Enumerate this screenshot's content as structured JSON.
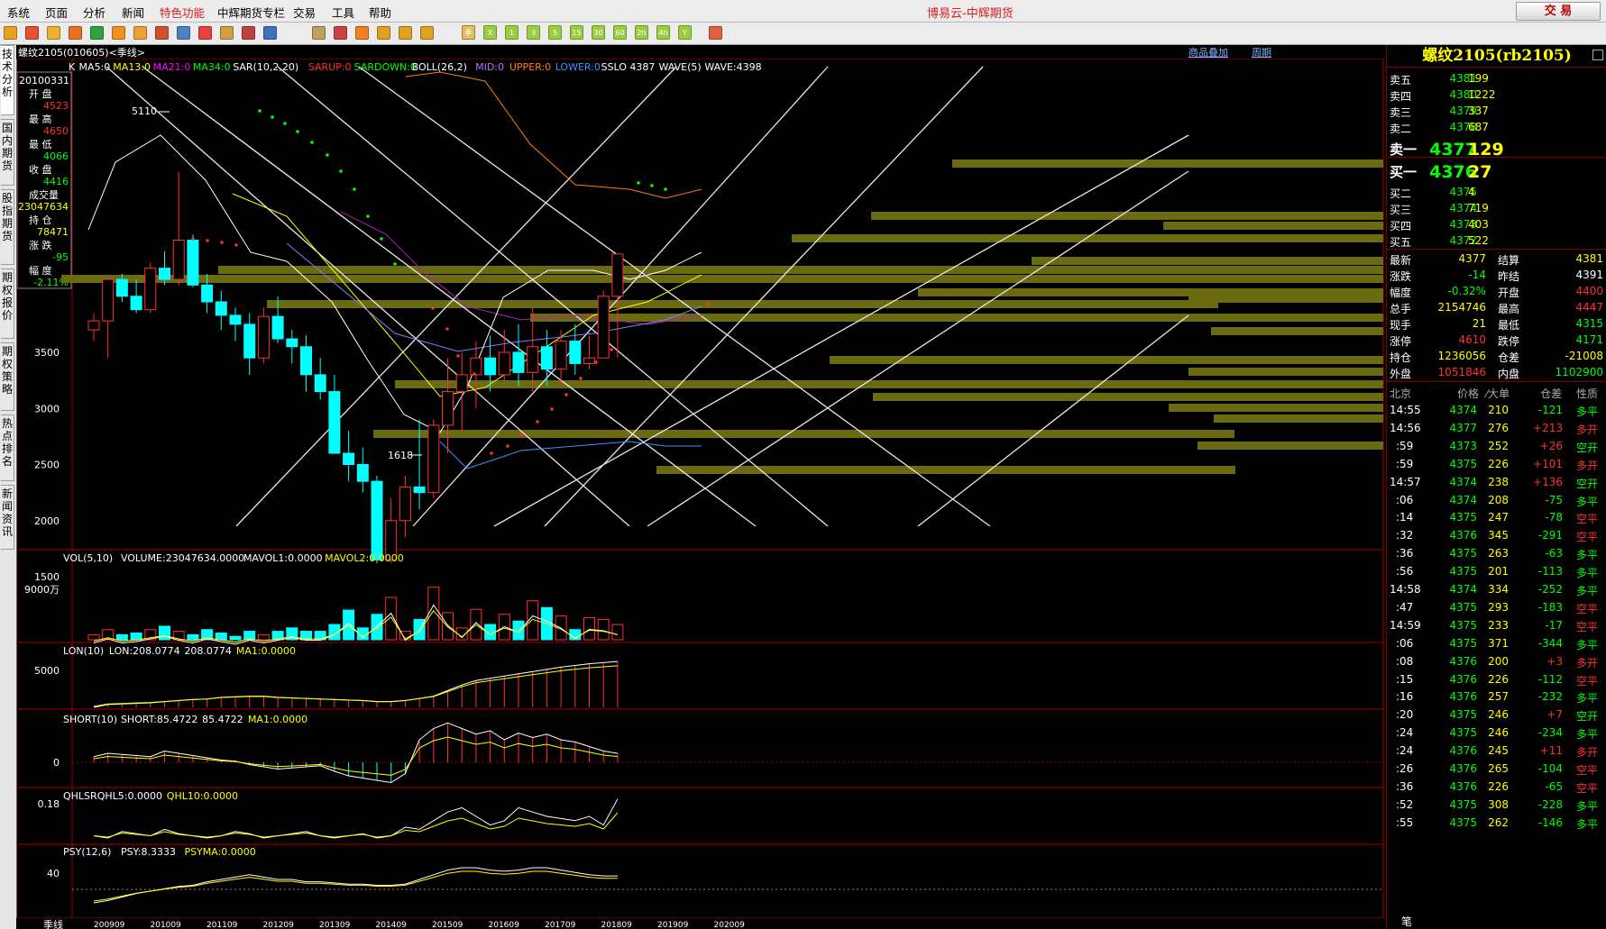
{
  "menu": {
    "items": [
      "系统",
      "页面",
      "分析",
      "新闻",
      "特色功能",
      "中辉期货专栏",
      "交易",
      "工具",
      "帮助"
    ],
    "app_title": "博易云-中辉期货",
    "trade_label": "交 易"
  },
  "toolbar": {
    "period_labels": [
      "日",
      "周",
      "月",
      "季",
      "X",
      "1",
      "3",
      "5",
      "15",
      "30",
      "60",
      "2h",
      "4h",
      "Y"
    ]
  },
  "sidetabs": [
    "技术分析",
    "国内期货",
    "股指期货",
    "期权报价",
    "期权策略",
    "热点排名",
    "新闻资讯"
  ],
  "chart": {
    "header": "螺纹2105(010605)<季线>",
    "link1": "商品叠加",
    "link2": "周期",
    "main_indicator_segments": [
      {
        "text": "K",
        "color": "#ffffff"
      },
      {
        "text": "MA5:0",
        "color": "#ffffff"
      },
      {
        "text": "MA13:0",
        "color": "#ffff00"
      },
      {
        "text": "MA21:0",
        "color": "#ff00ff"
      },
      {
        "text": "MA34:0",
        "color": "#00ff00"
      },
      {
        "text": "SAR(10,2,20)",
        "color": "#ffffff"
      },
      {
        "text": "SARUP:0",
        "color": "#ff3030"
      },
      {
        "text": "SARDOWN:0",
        "color": "#00ff00"
      },
      {
        "text": "BOLL(26,2)",
        "color": "#ffffff"
      },
      {
        "text": "MID:0",
        "color": "#b070ff"
      },
      {
        "text": "UPPER:0",
        "color": "#ff8000"
      },
      {
        "text": "LOWER:0",
        "color": "#4090ff"
      },
      {
        "text": "SSLO 4387",
        "color": "#ffffff"
      },
      {
        "text": "WAVE(5)",
        "color": "#ffffff"
      },
      {
        "text": "WAVE:4398",
        "color": "#ffffff"
      }
    ],
    "info_box": {
      "date": "20100331",
      "items": [
        {
          "label": "开 盘",
          "value": "4523",
          "color": "#ff3030"
        },
        {
          "label": "最 高",
          "value": "4650",
          "color": "#ff3030"
        },
        {
          "label": "最 低",
          "value": "4066",
          "color": "#00ff00"
        },
        {
          "label": "收 盘",
          "value": "4416",
          "color": "#00ff00"
        },
        {
          "label": "成交量",
          "value": "23047634",
          "color": "#ffff00"
        },
        {
          "label": "持 仓",
          "value": "78471",
          "color": "#ffff00"
        },
        {
          "label": "涨 跌",
          "value": "-95",
          "color": "#00ff00"
        },
        {
          "label": "幅 度",
          "value": "-2.11%",
          "color": "#00ff00"
        }
      ]
    },
    "y_axis_labels": [
      "3500",
      "3000",
      "2500",
      "2000",
      "1500"
    ],
    "peak_label": "5110",
    "trough_label": "1618",
    "vol_header": [
      {
        "text": "VOL(5,10)",
        "color": "#ffffff"
      },
      {
        "text": "VOLUME:23047634.0000",
        "color": "#ffffff"
      },
      {
        "text": "MAVOL1:0.0000",
        "color": "#ffffff"
      },
      {
        "text": "MAVOL2:0.0000",
        "color": "#ffff00"
      }
    ],
    "vol_axis": "9000万",
    "lon_header": [
      {
        "text": "LON(10)",
        "color": "#ffffff"
      },
      {
        "text": "LON:208.0774",
        "color": "#ffffff"
      },
      {
        "text": "208.0774",
        "color": "#ffffff"
      },
      {
        "text": "MA1:0.0000",
        "color": "#ffff00"
      }
    ],
    "lon_axis": "5000",
    "short_header": [
      {
        "text": "SHORT(10)",
        "color": "#ffffff"
      },
      {
        "text": "SHORT:85.4722",
        "color": "#ffffff"
      },
      {
        "text": "85.4722",
        "color": "#ffffff"
      },
      {
        "text": "MA1:0.0000",
        "color": "#ffff00"
      }
    ],
    "short_axis": "0",
    "qhlsr_header": [
      {
        "text": "QHLSR",
        "color": "#ffffff"
      },
      {
        "text": "QHL5:0.0000",
        "color": "#ffffff"
      },
      {
        "text": "QHL10:0.0000",
        "color": "#ffff00"
      }
    ],
    "qhlsr_axis": "0.18",
    "psy_header": [
      {
        "text": "PSY(12,6)",
        "color": "#ffffff"
      },
      {
        "text": "PSY:8.3333",
        "color": "#ffffff"
      },
      {
        "text": "PSYMA:0.0000",
        "color": "#ffff00"
      }
    ],
    "psy_axis": "40",
    "x_axis_label": "季线",
    "x_dates": [
      "200909",
      "201009",
      "201109",
      "201209",
      "201309",
      "201409",
      "201509",
      "201609",
      "201709",
      "201809",
      "201909",
      "202009"
    ],
    "candles": [
      [
        3700,
        3850,
        3600,
        3780
      ],
      [
        3780,
        3900,
        3450,
        4150
      ],
      [
        4150,
        4200,
        3950,
        4000
      ],
      [
        4000,
        4150,
        3850,
        3880
      ],
      [
        3880,
        4300,
        3850,
        4250
      ],
      [
        4250,
        4400,
        4100,
        4150
      ],
      [
        4150,
        5110,
        4100,
        4500
      ],
      [
        4500,
        4550,
        4080,
        4100
      ],
      [
        4100,
        4200,
        3850,
        3950
      ],
      [
        3950,
        4050,
        3700,
        3830
      ],
      [
        3830,
        3900,
        3600,
        3750
      ],
      [
        3750,
        3850,
        3300,
        3450
      ],
      [
        3450,
        3900,
        3400,
        3820
      ],
      [
        3820,
        4000,
        3580,
        3620
      ],
      [
        3620,
        3700,
        3400,
        3550
      ],
      [
        3550,
        3650,
        3150,
        3300
      ],
      [
        3300,
        3450,
        3080,
        3150
      ],
      [
        3150,
        3300,
        2800,
        2600
      ],
      [
        2600,
        2800,
        2350,
        2500
      ],
      [
        2500,
        2650,
        2250,
        2350
      ],
      [
        2350,
        2400,
        1618,
        1650
      ],
      [
        1650,
        2200,
        1620,
        2000
      ],
      [
        2000,
        2400,
        1850,
        2300
      ],
      [
        2300,
        2900,
        2100,
        2250
      ],
      [
        2250,
        2900,
        2200,
        2850
      ],
      [
        2850,
        3450,
        2600,
        3150
      ],
      [
        3150,
        3500,
        2800,
        3300
      ],
      [
        3300,
        3600,
        3000,
        3450
      ],
      [
        3450,
        3650,
        3150,
        3300
      ],
      [
        3300,
        3700,
        3250,
        3500
      ],
      [
        3500,
        3750,
        3200,
        3320
      ],
      [
        3320,
        3900,
        3150,
        3550
      ],
      [
        3550,
        3700,
        3200,
        3350
      ],
      [
        3350,
        3700,
        3200,
        3600
      ],
      [
        3600,
        3750,
        3300,
        3400
      ],
      [
        3400,
        3650,
        3350,
        3450
      ],
      [
        3450,
        4050,
        3700,
        4000
      ],
      [
        4000,
        4100,
        3450,
        4377
      ]
    ],
    "volumes": [
      6,
      12,
      6,
      8,
      12,
      16,
      10,
      6,
      12,
      8,
      4,
      10,
      6,
      10,
      14,
      10,
      10,
      18,
      35,
      14,
      30,
      50,
      10,
      24,
      62,
      32,
      14,
      36,
      18,
      30,
      22,
      46,
      38,
      28,
      12,
      26,
      24,
      18
    ],
    "lon": [
      0,
      5,
      6,
      7,
      8,
      10,
      12,
      14,
      15,
      18,
      19,
      20,
      20,
      18,
      17,
      16,
      15,
      14,
      13,
      12,
      10,
      10,
      12,
      16,
      20,
      30,
      40,
      48,
      52,
      56,
      60,
      64,
      68,
      72,
      75,
      78,
      80,
      82
    ],
    "short_vals": [
      5,
      8,
      7,
      6,
      5,
      10,
      8,
      6,
      4,
      2,
      1,
      -2,
      -4,
      -6,
      -5,
      -4,
      -3,
      -8,
      -12,
      -14,
      -16,
      -18,
      -10,
      20,
      30,
      35,
      30,
      25,
      28,
      20,
      26,
      22,
      25,
      20,
      18,
      14,
      10,
      8
    ],
    "qhlsr": [
      0.01,
      0.0,
      0.03,
      0.02,
      0.01,
      0.04,
      0.02,
      0.01,
      0.0,
      0.01,
      0.03,
      0.02,
      0.0,
      0.01,
      0.02,
      0.03,
      0.01,
      0.0,
      0.01,
      0.02,
      0.0,
      0.01,
      0.05,
      0.04,
      0.08,
      0.12,
      0.14,
      0.1,
      0.06,
      0.08,
      0.14,
      0.12,
      0.1,
      0.09,
      0.08,
      0.1,
      0.06,
      0.18
    ],
    "psy": [
      10,
      12,
      15,
      18,
      20,
      22,
      24,
      25,
      28,
      30,
      32,
      34,
      32,
      30,
      30,
      28,
      28,
      27,
      26,
      26,
      25,
      25,
      26,
      30,
      34,
      38,
      40,
      40,
      38,
      37,
      38,
      40,
      40,
      38,
      36,
      34,
      33,
      33
    ]
  },
  "quote": {
    "title": "螺纹2105(rb2105)",
    "asks": [
      {
        "label": "卖五",
        "price": "4381",
        "vol": "199"
      },
      {
        "label": "卖四",
        "price": "4380",
        "vol": "1222"
      },
      {
        "label": "卖三",
        "price": "4379",
        "vol": "337"
      },
      {
        "label": "卖二",
        "price": "4378",
        "vol": "687"
      },
      {
        "label": "卖一",
        "price": "4377",
        "vol": "129"
      }
    ],
    "bids": [
      {
        "label": "买一",
        "price": "4376",
        "vol": "27"
      },
      {
        "label": "买二",
        "price": "4375",
        "vol": "4"
      },
      {
        "label": "买三",
        "price": "4374",
        "vol": "719"
      },
      {
        "label": "买四",
        "price": "4373",
        "vol": "403"
      },
      {
        "label": "买五",
        "price": "4372",
        "vol": "522"
      }
    ],
    "stats": [
      [
        {
          "t": "最新",
          "c": "#ffffff"
        },
        {
          "t": "4377",
          "c": "#ffff00"
        },
        {
          "t": "结算",
          "c": "#ffffff"
        },
        {
          "t": "4381",
          "c": "#ffff00"
        }
      ],
      [
        {
          "t": "涨跌",
          "c": "#ffffff"
        },
        {
          "t": "-14",
          "c": "#00ff00"
        },
        {
          "t": "昨结",
          "c": "#ffffff"
        },
        {
          "t": "4391",
          "c": "#ffffff"
        }
      ],
      [
        {
          "t": "幅度",
          "c": "#ffffff"
        },
        {
          "t": "-0.32%",
          "c": "#00ff00"
        },
        {
          "t": "开盘",
          "c": "#ffffff"
        },
        {
          "t": "4400",
          "c": "#ff3030"
        }
      ],
      [
        {
          "t": "总手",
          "c": "#ffffff"
        },
        {
          "t": "2154746",
          "c": "#ffff00"
        },
        {
          "t": "最高",
          "c": "#ffffff"
        },
        {
          "t": "4447",
          "c": "#ff3030"
        }
      ],
      [
        {
          "t": "现手",
          "c": "#ffffff"
        },
        {
          "t": "21",
          "c": "#ffff00"
        },
        {
          "t": "最低",
          "c": "#ffffff"
        },
        {
          "t": "4315",
          "c": "#00ff00"
        }
      ],
      [
        {
          "t": "涨停",
          "c": "#ffffff"
        },
        {
          "t": "4610",
          "c": "#ff3030"
        },
        {
          "t": "跌停",
          "c": "#ffffff"
        },
        {
          "t": "4171",
          "c": "#00ff00"
        }
      ],
      [
        {
          "t": "持仓",
          "c": "#ffffff"
        },
        {
          "t": "1236056",
          "c": "#ffff00"
        },
        {
          "t": "仓差",
          "c": "#ffffff"
        },
        {
          "t": "-21008",
          "c": "#ffff00"
        }
      ],
      [
        {
          "t": "外盘",
          "c": "#ffffff"
        },
        {
          "t": "1051846",
          "c": "#ff3030"
        },
        {
          "t": "内盘",
          "c": "#ffffff"
        },
        {
          "t": "1102900",
          "c": "#00ff00"
        }
      ]
    ],
    "tick_header": [
      "北京",
      "价格",
      "⁄大单",
      "仓差",
      "性质"
    ],
    "ticks": [
      [
        "14:55",
        "4374",
        "210",
        "-121",
        "多平"
      ],
      [
        "14:56",
        "4377",
        "276",
        "+213",
        "多开"
      ],
      [
        ":59",
        "4373",
        "252",
        "+26",
        "空开"
      ],
      [
        ":59",
        "4375",
        "226",
        "+101",
        "多开"
      ],
      [
        "14:57",
        "4374",
        "238",
        "+136",
        "空开"
      ],
      [
        ":06",
        "4374",
        "208",
        "-75",
        "多平"
      ],
      [
        ":14",
        "4375",
        "247",
        "-78",
        "空平"
      ],
      [
        ":32",
        "4376",
        "345",
        "-291",
        "空平"
      ],
      [
        ":36",
        "4375",
        "263",
        "-63",
        "多平"
      ],
      [
        ":56",
        "4375",
        "201",
        "-113",
        "多平"
      ],
      [
        "14:58",
        "4374",
        "334",
        "-252",
        "多平"
      ],
      [
        ":47",
        "4375",
        "293",
        "-183",
        "空平"
      ],
      [
        "14:59",
        "4375",
        "233",
        "-17",
        "空平"
      ],
      [
        ":06",
        "4375",
        "371",
        "-344",
        "多平"
      ],
      [
        ":08",
        "4376",
        "200",
        "+3",
        "多开"
      ],
      [
        ":15",
        "4376",
        "226",
        "-112",
        "空平"
      ],
      [
        ":16",
        "4376",
        "257",
        "-232",
        "多平"
      ],
      [
        ":20",
        "4375",
        "246",
        "+7",
        "空开"
      ],
      [
        ":24",
        "4375",
        "246",
        "-234",
        "多平"
      ],
      [
        ":24",
        "4376",
        "245",
        "+11",
        "多开"
      ],
      [
        ":26",
        "4376",
        "265",
        "-104",
        "空平"
      ],
      [
        ":36",
        "4376",
        "226",
        "-65",
        "空平"
      ],
      [
        ":52",
        "4375",
        "308",
        "-228",
        "多平"
      ],
      [
        ":55",
        "4375",
        "262",
        "-146",
        "多平"
      ]
    ],
    "footer": "笔"
  },
  "colors": {
    "up": "#ff3030",
    "down": "#00ffff",
    "buy": "#ff3030",
    "sell": "#00ff00",
    "accent": "#ffff00"
  }
}
